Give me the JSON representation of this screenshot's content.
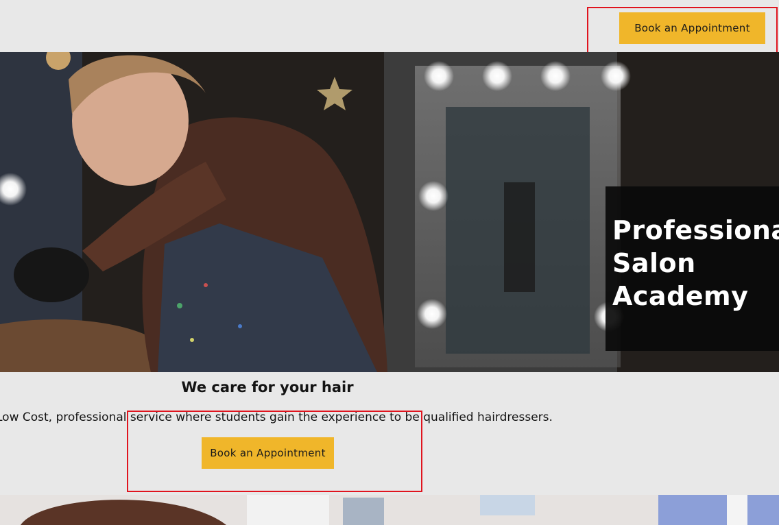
{
  "header": {
    "book_label": "Book an Appointment"
  },
  "hero": {
    "title": "Professional\nSalon\nAcademy",
    "image": "hairdresser-cutting-hair-photo"
  },
  "content": {
    "subtitle": "We care for your hair",
    "description": "Low Cost, professional service where students gain the experience to be qualified hairdressers.",
    "book_label": "Book an Appointment"
  },
  "bottom": {
    "image": "salon-interior-photo"
  },
  "colors": {
    "accent": "#f0b62a",
    "background": "#e8e8e8",
    "highlight": "#e0141e"
  }
}
